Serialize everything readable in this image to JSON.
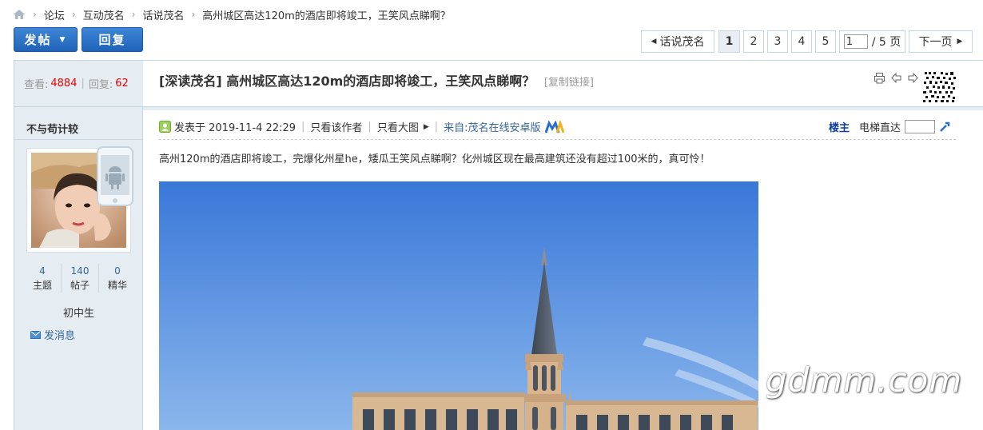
{
  "breadcrumb": {
    "items": [
      "论坛",
      "互动茂名",
      "话说茂名",
      "高州城区高达120m的酒店即将竣工，王笑风点睇啊？"
    ],
    "separator": "›"
  },
  "actions": {
    "post_label": "发帖",
    "reply_label": "回复"
  },
  "pager": {
    "back_label": "话说茂名",
    "pages": [
      "1",
      "2",
      "3",
      "4",
      "5"
    ],
    "current_page": "1",
    "total_label": "/ 5 页",
    "next_label": "下一页"
  },
  "stats": {
    "views_label": "查看:",
    "views": "4884",
    "replies_label": "回复:",
    "replies": "62"
  },
  "author": {
    "name": "不与苟计较",
    "counts": [
      {
        "value": "4",
        "label": "主题"
      },
      {
        "value": "140",
        "label": "帖子"
      },
      {
        "value": "0",
        "label": "精华"
      }
    ],
    "rank": "初中生",
    "message_label": "发消息"
  },
  "post": {
    "title": "[深读茂名] 高州城区高达120m的酒店即将竣工，王笑风点睇啊？",
    "copy_link": "[复制链接]",
    "posted_label": "发表于 2019-11-4 22:29",
    "only_author": "只看该作者",
    "big_image": "只看大图",
    "source": "来自:茂名在线安卓版",
    "floor_label": "楼主",
    "elevator_label": "电梯直达",
    "body": "高州120m的酒店即将竣工，完爆化州星he，矮瓜王笑风点睇啊？化州城区现在最高建筑还没有超过100米的，真可怜！"
  },
  "watermark": "gdmm.com",
  "colors": {
    "accent": "#336699",
    "red": "#ee0000",
    "sidebar_bg": "#e5edf2",
    "button_blue": "#2a71c6"
  }
}
